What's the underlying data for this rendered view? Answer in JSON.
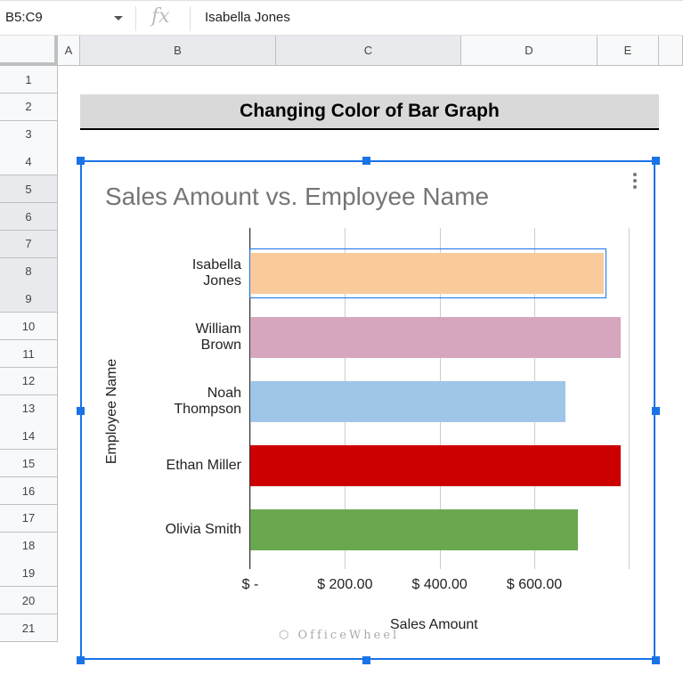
{
  "formula_bar": {
    "name_box": "B5:C9",
    "fx": "fx",
    "value": "Isabella Jones"
  },
  "columns": [
    "A",
    "B",
    "C",
    "D",
    "E"
  ],
  "rows": [
    "1",
    "2",
    "3",
    "4",
    "5",
    "6",
    "7",
    "8",
    "9",
    "10",
    "11",
    "12",
    "13",
    "14",
    "15",
    "16",
    "17",
    "18",
    "19",
    "20",
    "21"
  ],
  "sheet_title": "Changing Color of Bar Graph",
  "watermark": "OfficeWheel",
  "chart_data": {
    "type": "bar",
    "orientation": "horizontal",
    "title": "Sales Amount vs. Employee Name",
    "xlabel": "Sales Amount",
    "ylabel": "Employee Name",
    "categories": [
      "Isabella\nJones",
      "William\nBrown",
      "Noah\nThompson",
      "Ethan Miller",
      "Olivia Smith"
    ],
    "values": [
      746,
      782,
      665,
      782,
      692
    ],
    "colors": [
      "#f9cb9c",
      "#d5a6bd",
      "#9fc5e8",
      "#cc0000",
      "#6aa84f"
    ],
    "xlim": [
      0,
      800
    ],
    "xticks": [
      0,
      200,
      400,
      600,
      800
    ],
    "xtick_labels": [
      "$ -",
      "$ 200.00",
      "$ 400.00",
      "$ 600.00"
    ],
    "grid": true
  }
}
